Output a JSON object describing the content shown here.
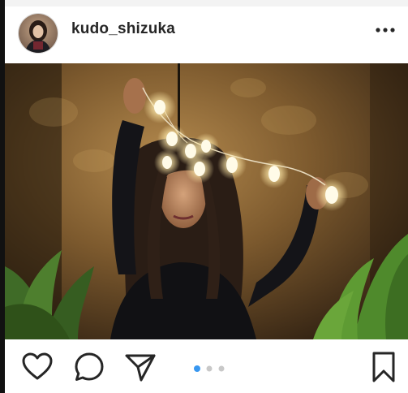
{
  "post": {
    "username": "kudo_shizuka",
    "carousel": {
      "current": 1,
      "total": 3
    }
  },
  "icons": {
    "more": "more-options-icon",
    "like": "heart-icon",
    "comment": "comment-icon",
    "share": "share-icon",
    "save": "bookmark-icon"
  },
  "colors": {
    "text": "#262626",
    "active_dot": "#3897f0",
    "inactive_dot": "#c8c8c8"
  }
}
